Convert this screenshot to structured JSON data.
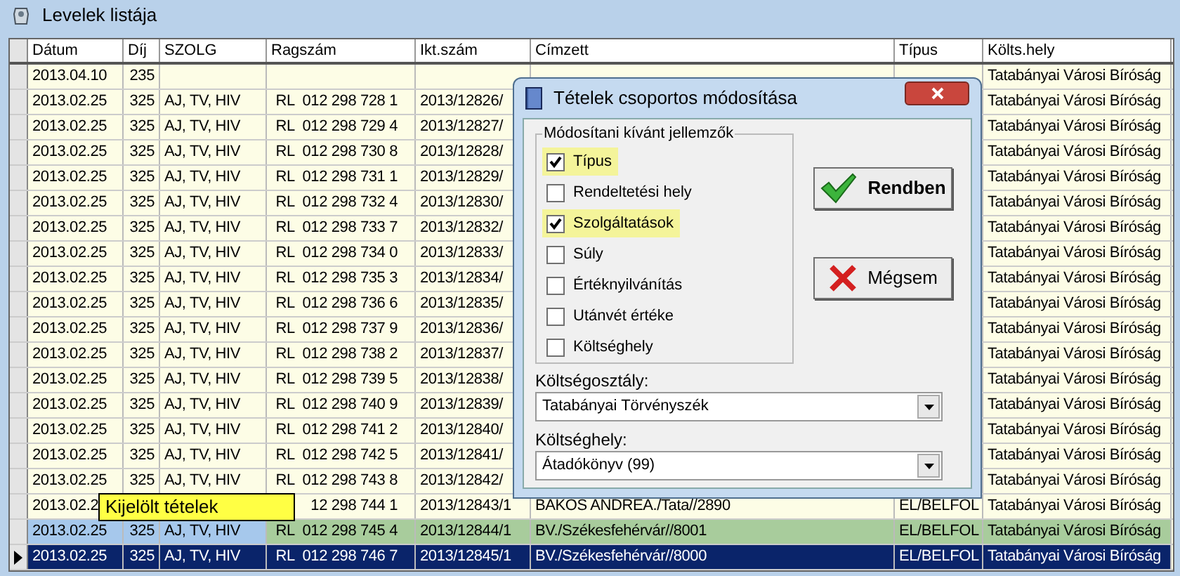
{
  "window": {
    "title": "Levelek listája"
  },
  "table": {
    "columns": [
      "Dátum",
      "Díj",
      "SZOLG",
      "Ragszám",
      "Ikt.szám",
      "Címzett",
      "Típus",
      "Költs.hely"
    ],
    "rows": [
      {
        "marked": false,
        "selected": false,
        "cells": {
          "datum": "2013.04.10",
          "dij": "235",
          "koltshely": "Tatabányai Városi Bíróság"
        }
      },
      {
        "marked": false,
        "selected": false,
        "cells": {
          "datum": "2013.02.25",
          "dij": "325",
          "szolg": "AJ, TV, HIV",
          "ragszam": "RL  012 298 728 1",
          "iktszam": "2013/12826/",
          "koltshely": "Tatabányai Városi Bíróság"
        }
      },
      {
        "marked": false,
        "selected": false,
        "cells": {
          "datum": "2013.02.25",
          "dij": "325",
          "szolg": "AJ, TV, HIV",
          "ragszam": "RL  012 298 729 4",
          "iktszam": "2013/12827/",
          "koltshely": "Tatabányai Városi Bíróság"
        }
      },
      {
        "marked": false,
        "selected": false,
        "cells": {
          "datum": "2013.02.25",
          "dij": "325",
          "szolg": "AJ, TV, HIV",
          "ragszam": "RL  012 298 730 8",
          "iktszam": "2013/12828/",
          "koltshely": "Tatabányai Városi Bíróság"
        }
      },
      {
        "marked": false,
        "selected": false,
        "cells": {
          "datum": "2013.02.25",
          "dij": "325",
          "szolg": "AJ, TV, HIV",
          "ragszam": "RL  012 298 731 1",
          "iktszam": "2013/12829/",
          "koltshely": "Tatabányai Városi Bíróság"
        }
      },
      {
        "marked": false,
        "selected": false,
        "cells": {
          "datum": "2013.02.25",
          "dij": "325",
          "szolg": "AJ, TV, HIV",
          "ragszam": "RL  012 298 732 4",
          "iktszam": "2013/12830/",
          "koltshely": "Tatabányai Városi Bíróság"
        }
      },
      {
        "marked": false,
        "selected": false,
        "cells": {
          "datum": "2013.02.25",
          "dij": "325",
          "szolg": "AJ, TV, HIV",
          "ragszam": "RL  012 298 733 7",
          "iktszam": "2013/12832/",
          "koltshely": "Tatabányai Városi Bíróság"
        }
      },
      {
        "marked": false,
        "selected": false,
        "cells": {
          "datum": "2013.02.25",
          "dij": "325",
          "szolg": "AJ, TV, HIV",
          "ragszam": "RL  012 298 734 0",
          "iktszam": "2013/12833/",
          "koltshely": "Tatabányai Városi Bíróság"
        }
      },
      {
        "marked": false,
        "selected": false,
        "cells": {
          "datum": "2013.02.25",
          "dij": "325",
          "szolg": "AJ, TV, HIV",
          "ragszam": "RL  012 298 735 3",
          "iktszam": "2013/12834/",
          "koltshely": "Tatabányai Városi Bíróság"
        }
      },
      {
        "marked": false,
        "selected": false,
        "cells": {
          "datum": "2013.02.25",
          "dij": "325",
          "szolg": "AJ, TV, HIV",
          "ragszam": "RL  012 298 736 6",
          "iktszam": "2013/12835/",
          "koltshely": "Tatabányai Városi Bíróság"
        }
      },
      {
        "marked": false,
        "selected": false,
        "cells": {
          "datum": "2013.02.25",
          "dij": "325",
          "szolg": "AJ, TV, HIV",
          "ragszam": "RL  012 298 737 9",
          "iktszam": "2013/12836/",
          "koltshely": "Tatabányai Városi Bíróság"
        }
      },
      {
        "marked": false,
        "selected": false,
        "cells": {
          "datum": "2013.02.25",
          "dij": "325",
          "szolg": "AJ, TV, HIV",
          "ragszam": "RL  012 298 738 2",
          "iktszam": "2013/12837/",
          "koltshely": "Tatabányai Városi Bíróság"
        }
      },
      {
        "marked": false,
        "selected": false,
        "cells": {
          "datum": "2013.02.25",
          "dij": "325",
          "szolg": "AJ, TV, HIV",
          "ragszam": "RL  012 298 739 5",
          "iktszam": "2013/12838/",
          "koltshely": "Tatabányai Városi Bíróság"
        }
      },
      {
        "marked": false,
        "selected": false,
        "cells": {
          "datum": "2013.02.25",
          "dij": "325",
          "szolg": "AJ, TV, HIV",
          "ragszam": "RL  012 298 740 9",
          "iktszam": "2013/12839/",
          "koltshely": "Tatabányai Városi Bíróság"
        }
      },
      {
        "marked": false,
        "selected": false,
        "cells": {
          "datum": "2013.02.25",
          "dij": "325",
          "szolg": "AJ, TV, HIV",
          "ragszam": "RL  012 298 741 2",
          "iktszam": "2013/12840/",
          "koltshely": "Tatabányai Városi Bíróság"
        }
      },
      {
        "marked": false,
        "selected": false,
        "cells": {
          "datum": "2013.02.25",
          "dij": "325",
          "szolg": "AJ, TV, HIV",
          "ragszam": "RL  012 298 742 5",
          "iktszam": "2013/12841/",
          "koltshely": "Tatabányai Városi Bíróság"
        }
      },
      {
        "marked": false,
        "selected": false,
        "cells": {
          "datum": "2013.02.25",
          "dij": "325",
          "szolg": "AJ, TV, HIV",
          "ragszam": "RL  012 298 743 8",
          "iktszam": "2013/12842/",
          "koltshely": "Tatabányai Városi Bíróság"
        }
      },
      {
        "marked": false,
        "selected": false,
        "cells": {
          "datum": "2013.02.2",
          "ragszam": "12 298 744 1",
          "iktszam": "2013/12843/1",
          "cimzett": "BAKOS ANDREA./Tata//2890",
          "tipus": "EL/BELFOL",
          "koltshely": "Tatabányai Városi Bíróság"
        }
      },
      {
        "marked": true,
        "selected": false,
        "cells": {
          "datum": "2013.02.25",
          "dij": "325",
          "szolg": "AJ, TV, HIV",
          "ragszam": "RL  012 298 745 4",
          "iktszam": "2013/12844/1",
          "cimzett": "BV./Székesfehérvár//8001",
          "tipus": "EL/BELFOL",
          "koltshely": "Tatabányai Városi Bíróság"
        }
      },
      {
        "marked": false,
        "selected": true,
        "cells": {
          "datum": "2013.02.25",
          "dij": "325",
          "szolg": "AJ, TV, HIV",
          "ragszam": "RL  012 298 746 7",
          "iktszam": "2013/12845/1",
          "cimzett": "BV./Székesfehérvár//8000",
          "tipus": "EL/BELFOL",
          "koltshely": "Tatabányai Városi Bíróság"
        }
      }
    ]
  },
  "tooltip": "Kijelölt tételek",
  "dialog": {
    "title": "Tételek csoportos módosítása",
    "group": {
      "title": "Módosítani kívánt jellemzők",
      "options": [
        {
          "label": "Típus",
          "checked": true
        },
        {
          "label": "Rendeltetési hely",
          "checked": false
        },
        {
          "label": "Szolgáltatások",
          "checked": true
        },
        {
          "label": "Súly",
          "checked": false
        },
        {
          "label": "Értéknyilvánítás",
          "checked": false
        },
        {
          "label": "Utánvét értéke",
          "checked": false
        },
        {
          "label": "Költséghely",
          "checked": false
        }
      ]
    },
    "buttons": [
      {
        "kind": "ok",
        "label": "Rendben"
      },
      {
        "kind": "cancel",
        "label": "Mégsem"
      }
    ],
    "fields": [
      {
        "label": "Költségosztály:",
        "value": "Tatabányai Törvényszék"
      },
      {
        "label": "Költséghely:",
        "value": "Átadókönyv (99)"
      }
    ]
  }
}
